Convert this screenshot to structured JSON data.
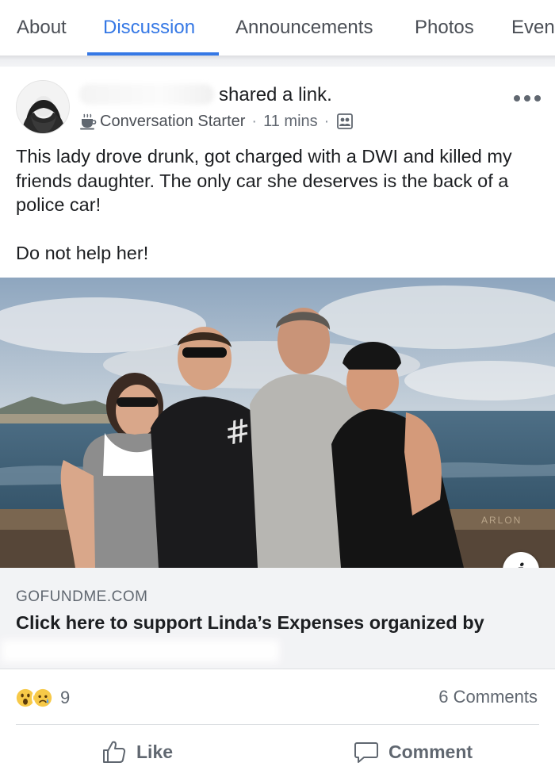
{
  "tabs": [
    {
      "label": "About",
      "active": false
    },
    {
      "label": "Discussion",
      "active": true
    },
    {
      "label": "Announcements",
      "active": false
    },
    {
      "label": "Photos",
      "active": false
    },
    {
      "label": "Even",
      "active": false
    }
  ],
  "post": {
    "action_text": "shared a link.",
    "badge": "Conversation Starter",
    "time": "11 mins",
    "privacy_icon": "group-icon",
    "body_paragraphs": [
      "This lady drove drunk, got charged with a DWI and killed my friends daughter. The only car she deserves is the back of a police car!",
      "Do not help her!"
    ],
    "photo_sign_text": "ARLON",
    "link": {
      "domain": "GOFUNDME.COM",
      "title": "Click here to support Linda’s Expenses organized by"
    },
    "reactions": {
      "icons": [
        "wow-reaction-icon",
        "sad-reaction-icon"
      ],
      "count": "9"
    },
    "comments_count": "6 Comments",
    "actions": {
      "like": "Like",
      "comment": "Comment"
    }
  },
  "colors": {
    "accent": "#3578e5",
    "text": "#1c1e21",
    "muted": "#606770",
    "link_box": "#f2f3f5"
  }
}
